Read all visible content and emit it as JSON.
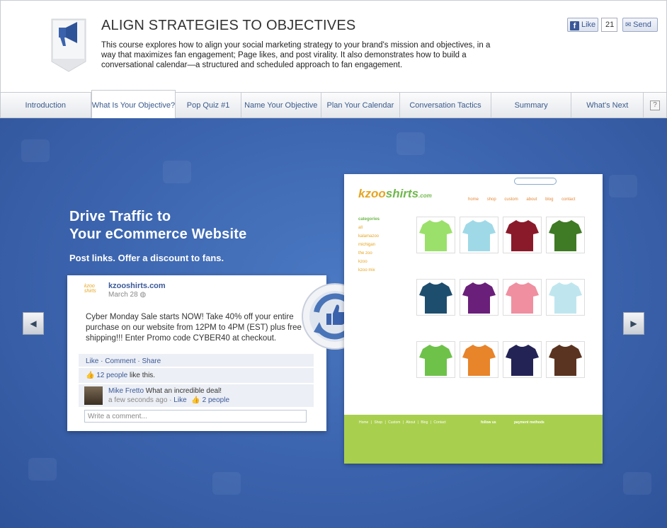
{
  "header": {
    "title": "ALIGN STRATEGIES TO OBJECTIVES",
    "description": "This course explores how to align your social marketing strategy to your brand's mission and objectives, in a way that maximizes fan engagement; Page likes, and post virality. It also demonstrates how to build a conversational calendar—a structured and scheduled approach to fan engagement.",
    "like_label": "Like",
    "like_count": "21",
    "send_label": "Send",
    "badge_icon": "megaphone-icon"
  },
  "nav": {
    "tabs": [
      {
        "label": "Introduction"
      },
      {
        "label": "What Is Your Objective?"
      },
      {
        "label": "Pop Quiz #1"
      },
      {
        "label": "Name Your Objective"
      },
      {
        "label": "Plan Your Calendar"
      },
      {
        "label": "Conversation Tactics"
      },
      {
        "label": "Summary"
      },
      {
        "label": "What's Next"
      }
    ],
    "help_label": "?"
  },
  "slide": {
    "headline_line1": "Drive Traffic to",
    "headline_line2": "Your eCommerce Website",
    "subhead": "Post links. Offer a discount to fans.",
    "fb_post": {
      "page_name": "kzooshirts.com",
      "date": "March 28",
      "text": "Cyber Monday Sale starts NOW! Take 40% off your entire purchase on our website from 12PM to 4PM (EST) plus free shipping!!! Enter Promo code CYBER40 at checkout.",
      "actions": [
        "Like",
        "Comment",
        "Share"
      ],
      "likes_count": "12 people",
      "likes_suffix": "like this.",
      "comment_author": "Mike Fretto",
      "comment_text": "What an incredible deal!",
      "comment_time": "a few seconds ago",
      "comment_like": "Like",
      "comment_likes": "2 people",
      "input_placeholder": "Write a comment..."
    },
    "shop": {
      "logo_main": "kzoo",
      "logo_accent": "shirts",
      "logo_suffix": ".com",
      "nav_items": [
        "home",
        "shop",
        "custom",
        "about",
        "blog",
        "contact"
      ],
      "categories_title": "categories",
      "categories": [
        "all",
        "kalamazoo",
        "michigan",
        "the zoo",
        "kzoo",
        "kzoo mix"
      ],
      "follow_label": "follow us",
      "payment_label": "payment methods",
      "footer_links": "Home | Shop | Custom | About | Blog | Contact",
      "shirt_colors": [
        "#9be06a",
        "#9fd9e8",
        "#8a1a2a",
        "#3f7a24",
        "#1e4e6e",
        "#6a1f7a",
        "#ef8fa0",
        "#bfe6ee",
        "#6ec24a",
        "#e8842a",
        "#232355",
        "#5a3420"
      ]
    }
  },
  "colors": {
    "accent": "#3b5998",
    "stage_bg": "#3b63ad",
    "shop_green": "#a9cf4e"
  }
}
